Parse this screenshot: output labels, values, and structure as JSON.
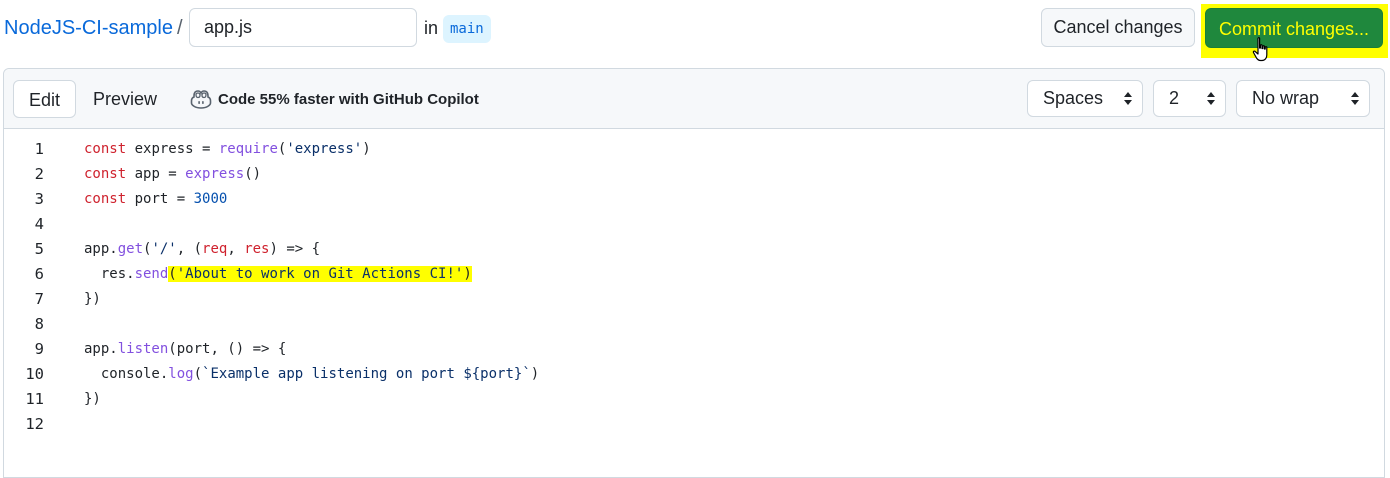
{
  "header": {
    "repo_name": "NodeJS-CI-sample",
    "separator": "/",
    "filename_value": "app.js",
    "in_label": "in",
    "branch": "main",
    "cancel_label": "Cancel changes",
    "commit_label": "Commit changes..."
  },
  "toolbar": {
    "tab_edit": "Edit",
    "tab_preview": "Preview",
    "copilot_text": "Code 55% faster with GitHub Copilot",
    "indent_mode": "Spaces",
    "indent_size": "2",
    "wrap_mode": "No wrap"
  },
  "code": {
    "line_numbers": [
      "1",
      "2",
      "3",
      "4",
      "5",
      "6",
      "7",
      "8",
      "9",
      "10",
      "11",
      "12"
    ],
    "lines": [
      "const express = require('express')",
      "const app = express()",
      "const port = 3000",
      "",
      "app.get('/', (req, res) => {",
      "  res.send('About to work on Git Actions CI!')",
      "})",
      "",
      "app.listen(port, () => {",
      "  console.log(`Example app listening on port ${port}`)",
      "})",
      ""
    ]
  },
  "colors": {
    "link": "#0969da",
    "commit_button_bg": "#1f883d",
    "highlight": "#ffff00",
    "keyword": "#cf222e",
    "function": "#8250df",
    "string": "#0a3069"
  },
  "icons": {
    "copilot": "copilot-icon",
    "select_arrows": "chevron-updown-icon",
    "cursor": "hand-pointer-icon"
  }
}
